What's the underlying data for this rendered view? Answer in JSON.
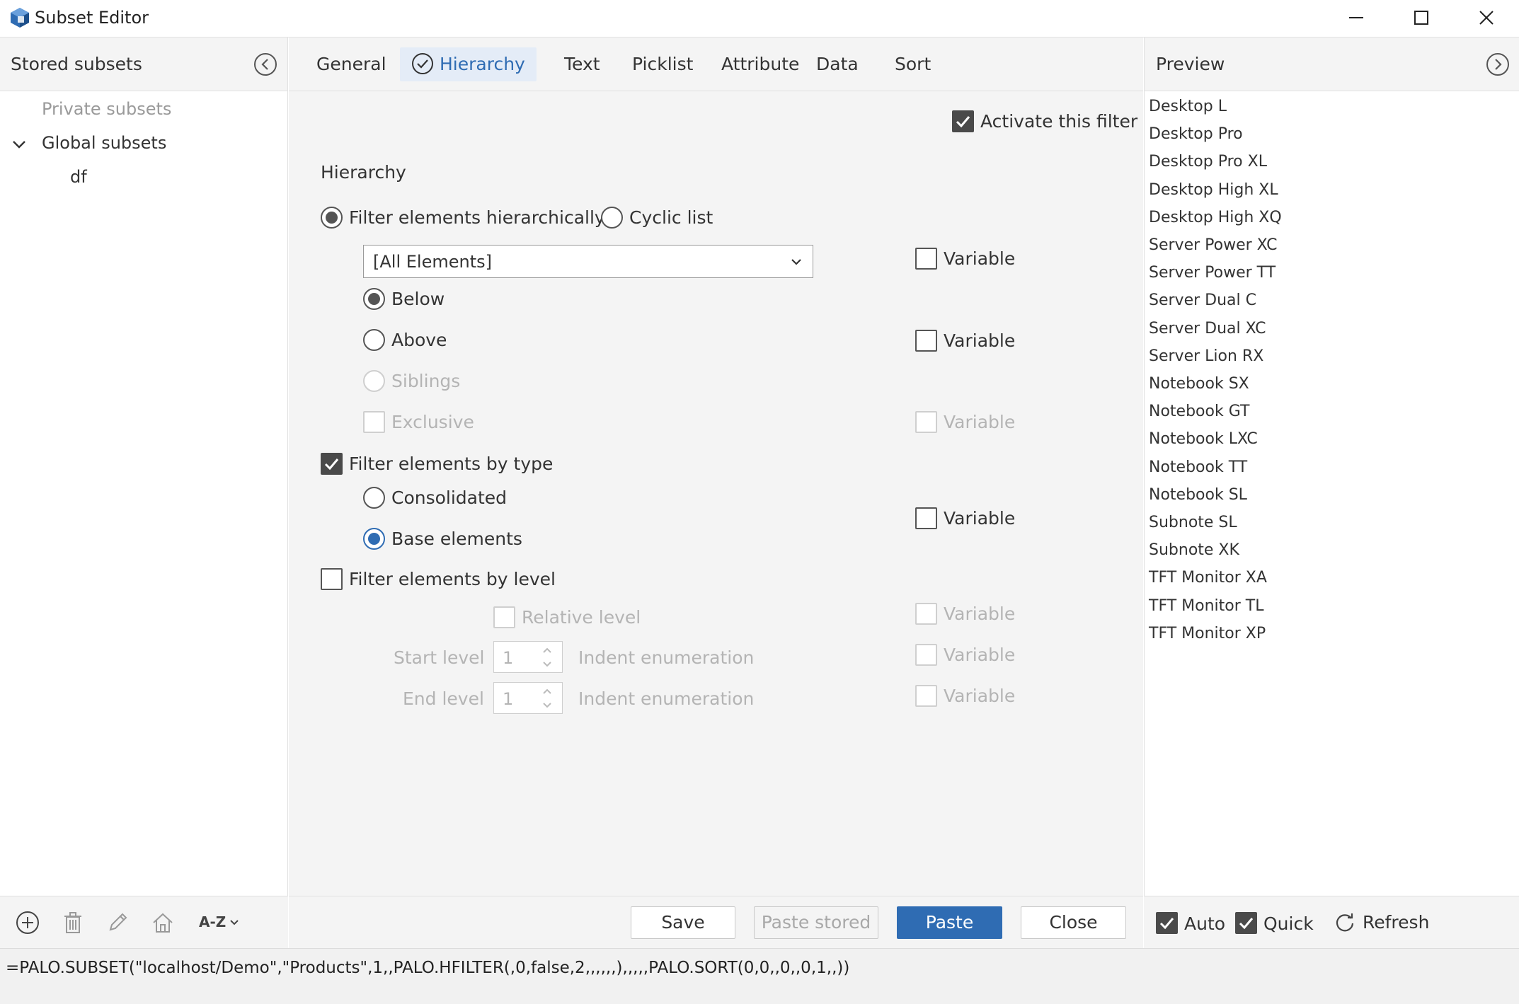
{
  "window": {
    "title": "Subset Editor"
  },
  "left_panel": {
    "header": "Stored subsets",
    "tree": [
      {
        "label": "Private subsets"
      },
      {
        "label": "Global subsets"
      },
      {
        "label": "df"
      }
    ],
    "sort_label": "A-Z"
  },
  "tabs": [
    {
      "label": "General"
    },
    {
      "label": "Hierarchy"
    },
    {
      "label": "Text"
    },
    {
      "label": "Picklist"
    },
    {
      "label": "Attribute"
    },
    {
      "label": "Data"
    },
    {
      "label": "Sort"
    }
  ],
  "hierarchy": {
    "activate_filter": "Activate this filter",
    "section_title": "Hierarchy",
    "filter_hierarchically": "Filter elements hierarchically",
    "cyclic_list": "Cyclic list",
    "element_dropdown": "[All Elements]",
    "variable": "Variable",
    "below": "Below",
    "above": "Above",
    "siblings": "Siblings",
    "exclusive": "Exclusive",
    "filter_by_type": "Filter elements by type",
    "consolidated": "Consolidated",
    "base_elements": "Base elements",
    "filter_by_level": "Filter elements by level",
    "relative_level": "Relative level",
    "start_level": "Start level",
    "start_level_value": "1",
    "end_level": "End level",
    "end_level_value": "1",
    "indent_enumeration": "Indent enumeration"
  },
  "buttons": {
    "save": "Save",
    "paste_stored": "Paste stored",
    "paste": "Paste",
    "close": "Close"
  },
  "preview": {
    "header": "Preview",
    "items": [
      "Desktop L",
      "Desktop Pro",
      "Desktop Pro XL",
      "Desktop High XL",
      "Desktop High XQ",
      "Server Power XC",
      "Server Power TT",
      "Server Dual C",
      "Server Dual XC",
      "Server Lion RX",
      "Notebook SX",
      "Notebook GT",
      "Notebook LXC",
      "Notebook TT",
      "Notebook SL",
      "Subnote SL",
      "Subnote XK",
      "TFT Monitor XA",
      "TFT Monitor TL",
      "TFT Monitor XP"
    ],
    "auto": "Auto",
    "quick": "Quick",
    "refresh": "Refresh"
  },
  "formula": "=PALO.SUBSET(\"localhost/Demo\",\"Products\",1,,PALO.HFILTER(,0,false,2,,,,,,),,,,,PALO.SORT(0,0,,0,,0,1,,))",
  "colors": {
    "accent": "#2f6cb3",
    "active_tab_bg": "#e4ecf7",
    "panel_bg": "#f4f4f4"
  }
}
